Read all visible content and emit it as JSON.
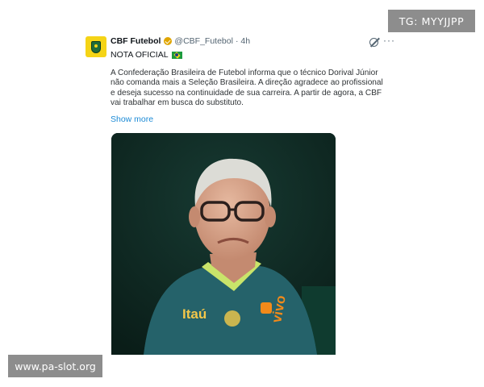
{
  "watermarks": {
    "top_right": "TG: MYYJJPP",
    "bottom_left": "www.pa-slot.org"
  },
  "tweet": {
    "author": {
      "display_name": "CBF Futebol",
      "handle": "@CBF_Futebol",
      "time": "· 4h",
      "verified_color": "#e0a500",
      "avatar_color": "#f5d416"
    },
    "heading": "NOTA OFICIAL",
    "body_lines": [
      "A Confederação Brasileira de Futebol informa que o técnico Dorival Júnior",
      "não comanda mais a Seleção Brasileira. A direção agradece ao profissional",
      "e deseja sucesso na continuidade de sua carreira. A partir de agora, a CBF",
      "vai trabalhar em busca do substituto."
    ],
    "show_more": "Show more",
    "link_color": "#1d8bd6",
    "icons": {
      "grok": "grok-icon",
      "more": "more-icon",
      "flag": "brazil-flag-icon"
    },
    "photo": {
      "jersey_text_1": "vivo",
      "jersey_text_2": "Itaú"
    }
  }
}
